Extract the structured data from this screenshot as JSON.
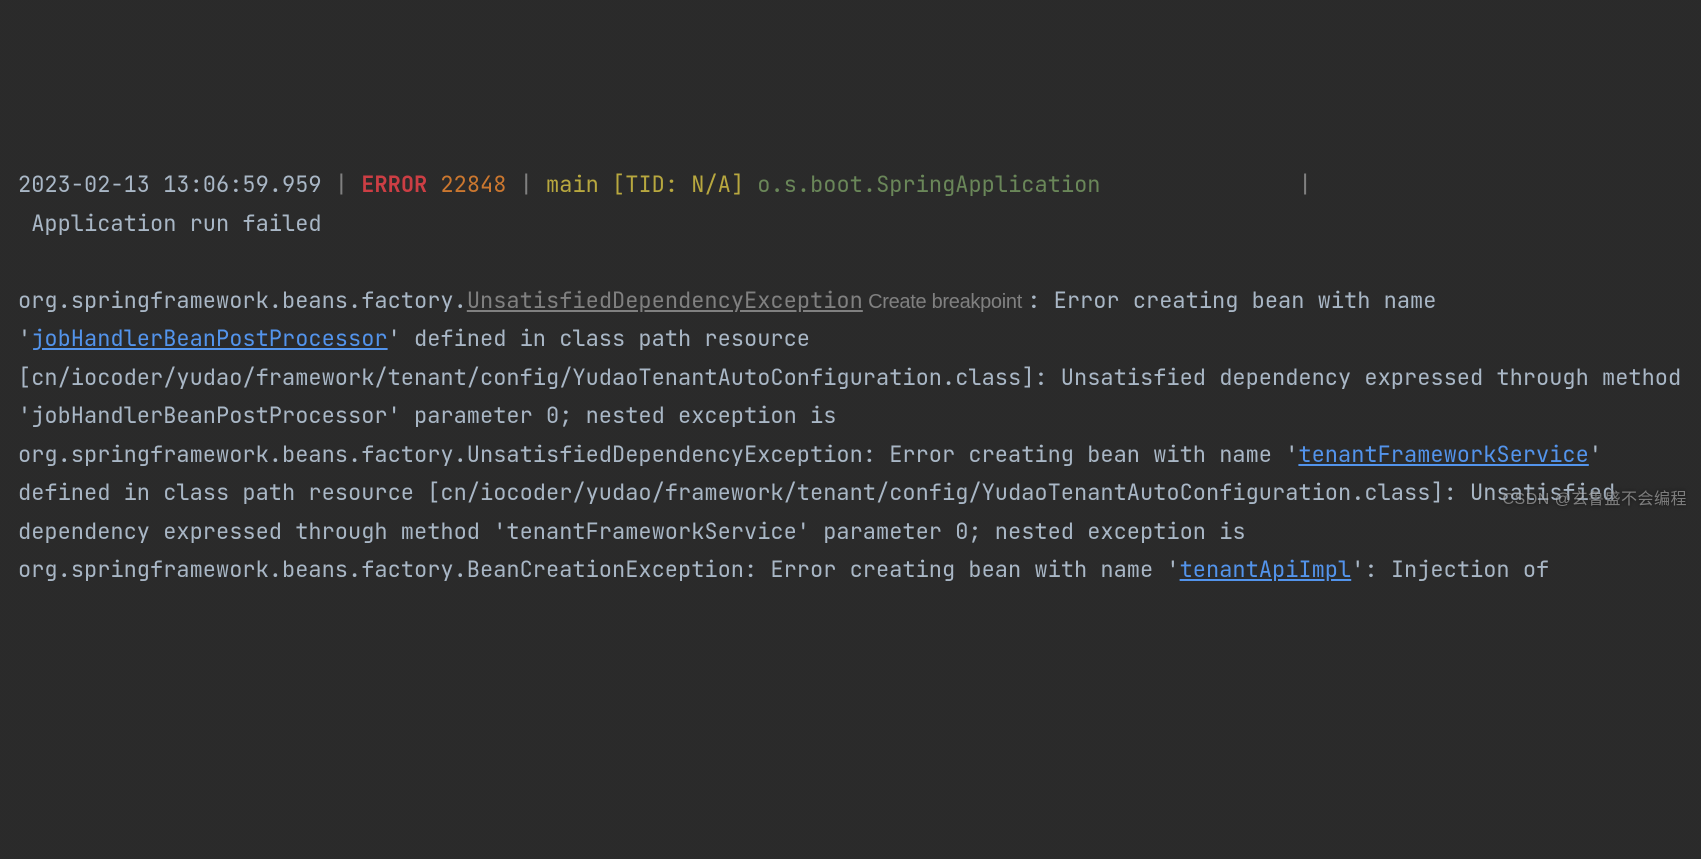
{
  "header": {
    "timestamp": "2023-02-13 13:06:59.959",
    "sep": " | ",
    "level": "ERROR",
    "pid": " 22848",
    "thread": "main [TID: N/A]",
    "logger": "o.s.boot.SpringApplication",
    "divider": "               |",
    "message": " Application run failed"
  },
  "trace": {
    "t1": "org.springframework.beans.factory.",
    "exClass": "UnsatisfiedDependencyException",
    "createBp": " Create breakpoint ",
    "t2": ": Error creating bean with name '",
    "link1": "jobHandlerBeanPostProcessor",
    "t3": "' defined in class path resource [cn/iocoder/yudao/framework/tenant/config/YudaoTenantAutoConfiguration.class]: Unsatisfied dependency expressed through method 'jobHandlerBeanPostProcessor' parameter 0; nested exception is org.springframework.beans.factory.UnsatisfiedDependencyException: Error creating bean with name '",
    "link2": "tenantFrameworkService",
    "t4": "' defined in class path resource [cn/iocoder/yudao/framework/tenant/config/YudaoTenantAutoConfiguration.class]: Unsatisfied dependency expressed through method 'tenantFrameworkService' parameter 0; nested exception is org.springframework.beans.factory.BeanCreationException: Error creating bean with name '",
    "link3": "tenantApiImpl",
    "t5": "': Injection of"
  },
  "watermark": "CSDN @玄鲁盛不会编程"
}
